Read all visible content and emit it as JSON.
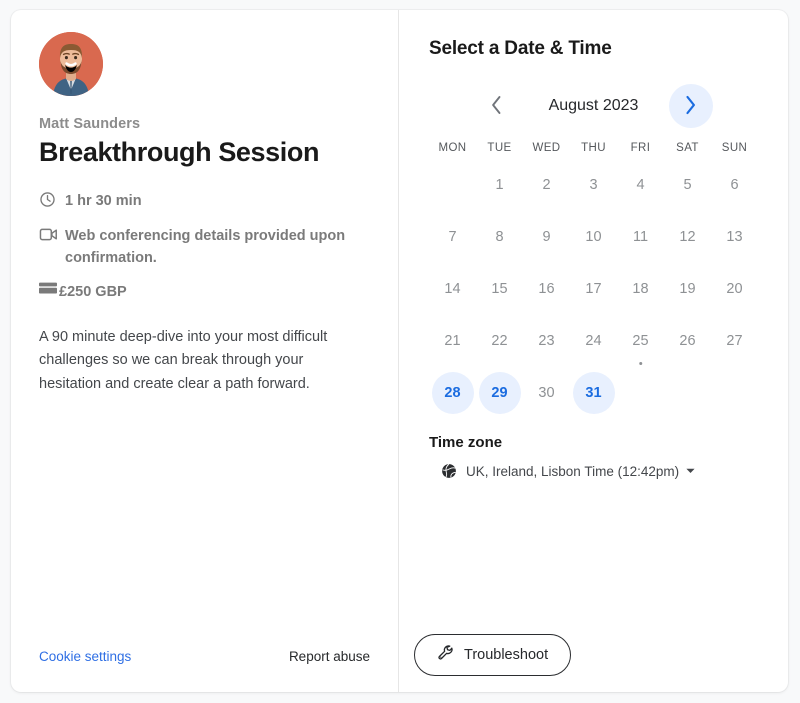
{
  "event": {
    "host_name": "Matt Saunders",
    "title": "Breakthrough Session",
    "duration": "1 hr 30 min",
    "location": "Web conferencing details provided upon confirmation.",
    "price": "£250 GBP",
    "description": "A 90 minute deep-dive into your most difficult challenges so we can break through your hesitation and create clear a path forward.",
    "icons": {
      "duration": "clock-icon",
      "location": "video-camera-icon",
      "price": "credit-card-icon"
    }
  },
  "left_footer": {
    "cookie_settings": "Cookie settings",
    "report_abuse": "Report abuse"
  },
  "scheduler": {
    "title": "Select a Date & Time",
    "month_label": "August 2023",
    "prev_icon": "chevron-left-icon",
    "next_icon": "chevron-right-icon",
    "weekdays": [
      "MON",
      "TUE",
      "WED",
      "THU",
      "FRI",
      "SAT",
      "SUN"
    ],
    "weeks": [
      [
        {
          "day": "",
          "state": "empty"
        },
        {
          "day": "1",
          "state": "unavailable"
        },
        {
          "day": "2",
          "state": "unavailable"
        },
        {
          "day": "3",
          "state": "unavailable"
        },
        {
          "day": "4",
          "state": "unavailable"
        },
        {
          "day": "5",
          "state": "unavailable"
        },
        {
          "day": "6",
          "state": "unavailable"
        }
      ],
      [
        {
          "day": "7",
          "state": "unavailable"
        },
        {
          "day": "8",
          "state": "unavailable"
        },
        {
          "day": "9",
          "state": "unavailable"
        },
        {
          "day": "10",
          "state": "unavailable"
        },
        {
          "day": "11",
          "state": "unavailable"
        },
        {
          "day": "12",
          "state": "unavailable"
        },
        {
          "day": "13",
          "state": "unavailable"
        }
      ],
      [
        {
          "day": "14",
          "state": "unavailable"
        },
        {
          "day": "15",
          "state": "unavailable"
        },
        {
          "day": "16",
          "state": "unavailable"
        },
        {
          "day": "17",
          "state": "unavailable"
        },
        {
          "day": "18",
          "state": "unavailable"
        },
        {
          "day": "19",
          "state": "unavailable"
        },
        {
          "day": "20",
          "state": "unavailable"
        }
      ],
      [
        {
          "day": "21",
          "state": "unavailable"
        },
        {
          "day": "22",
          "state": "unavailable"
        },
        {
          "day": "23",
          "state": "unavailable"
        },
        {
          "day": "24",
          "state": "unavailable"
        },
        {
          "day": "25",
          "state": "unavailable",
          "today": true
        },
        {
          "day": "26",
          "state": "unavailable"
        },
        {
          "day": "27",
          "state": "unavailable"
        }
      ],
      [
        {
          "day": "28",
          "state": "available"
        },
        {
          "day": "29",
          "state": "available"
        },
        {
          "day": "30",
          "state": "unavailable"
        },
        {
          "day": "31",
          "state": "available"
        },
        {
          "day": "",
          "state": "empty"
        },
        {
          "day": "",
          "state": "empty"
        },
        {
          "day": "",
          "state": "empty"
        }
      ]
    ],
    "timezone": {
      "label": "Time zone",
      "value": "UK, Ireland, Lisbon Time (12:42pm)",
      "icon": "globe-icon",
      "caret": "caret-down-icon"
    },
    "troubleshoot": {
      "label": "Troubleshoot",
      "icon": "wrench-icon"
    }
  },
  "colors": {
    "accent_blue": "#1b6ce0",
    "accent_blue_bg": "#e8f0fe",
    "link_blue": "#2f6fe4",
    "avatar_bg": "#d9694f",
    "page_bg": "#f8f9fa"
  }
}
